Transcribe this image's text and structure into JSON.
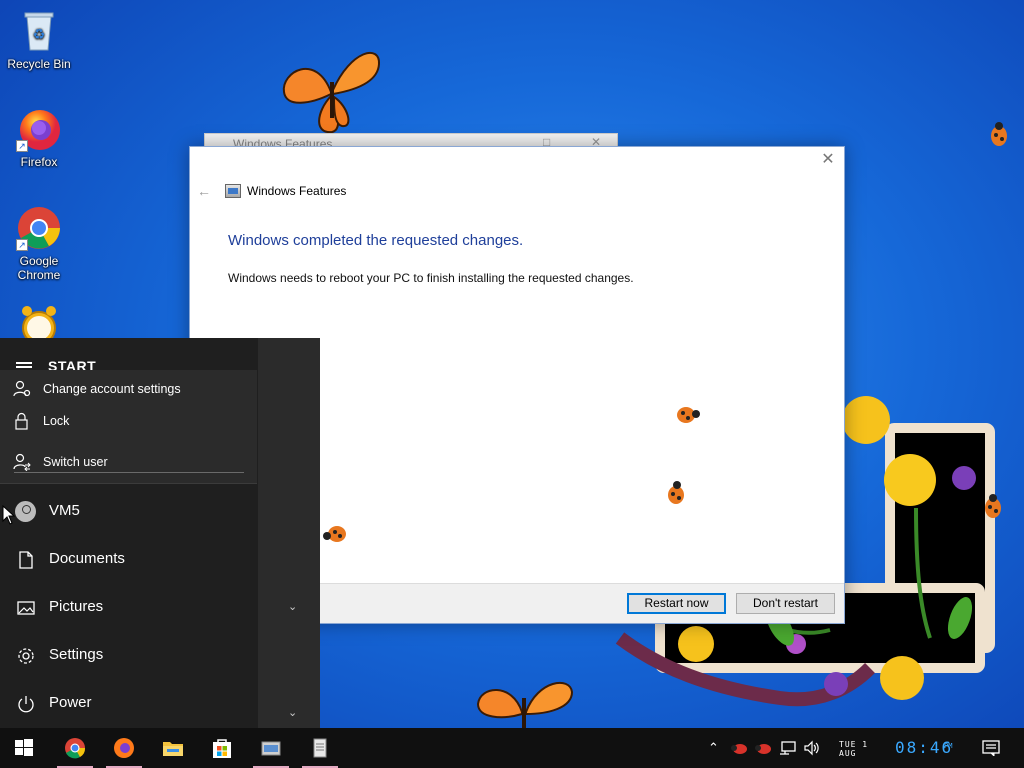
{
  "desktop": {
    "icons": [
      {
        "label": "Recycle Bin",
        "icon": "recycle-bin-icon"
      },
      {
        "label": "Firefox",
        "icon": "firefox-icon"
      },
      {
        "label": "Google Chrome",
        "icon": "chrome-icon"
      },
      {
        "label": "",
        "icon": "alarm-clock-icon"
      }
    ]
  },
  "background_window": {
    "title": "Windows Features"
  },
  "dialog": {
    "app_title": "Windows Features",
    "heading": "Windows completed the requested changes.",
    "message": "Windows needs to reboot your PC to finish installing the requested changes.",
    "buttons": {
      "restart": "Restart now",
      "dont_restart": "Don't restart"
    }
  },
  "start_menu": {
    "header": "START",
    "account_popup": [
      {
        "label": "Change account settings",
        "icon": "user-settings-icon"
      },
      {
        "label": "Lock",
        "icon": "lock-icon"
      },
      {
        "label": "Switch user",
        "icon": "switch-user-icon"
      }
    ],
    "items": [
      {
        "label": "VM5",
        "icon": "avatar"
      },
      {
        "label": "Documents",
        "icon": "document-icon"
      },
      {
        "label": "Pictures",
        "icon": "pictures-icon"
      },
      {
        "label": "Settings",
        "icon": "gear-icon"
      },
      {
        "label": "Power",
        "icon": "power-icon"
      }
    ]
  },
  "taskbar": {
    "pinned": [
      "start-icon",
      "chrome-icon",
      "firefox-icon",
      "file-explorer-icon",
      "store-icon",
      "windows-features-icon",
      "notepad-icon"
    ],
    "tray": {
      "day": "TUE",
      "date_num": "1",
      "month": "AUG",
      "time": "08:46",
      "ampm": "PM"
    }
  },
  "colors": {
    "accent": "#0078d7",
    "heading": "#1f3f9a",
    "clock": "#3aa9ff",
    "taskbar": "#101010",
    "start_menu": "#2b2b2b"
  }
}
